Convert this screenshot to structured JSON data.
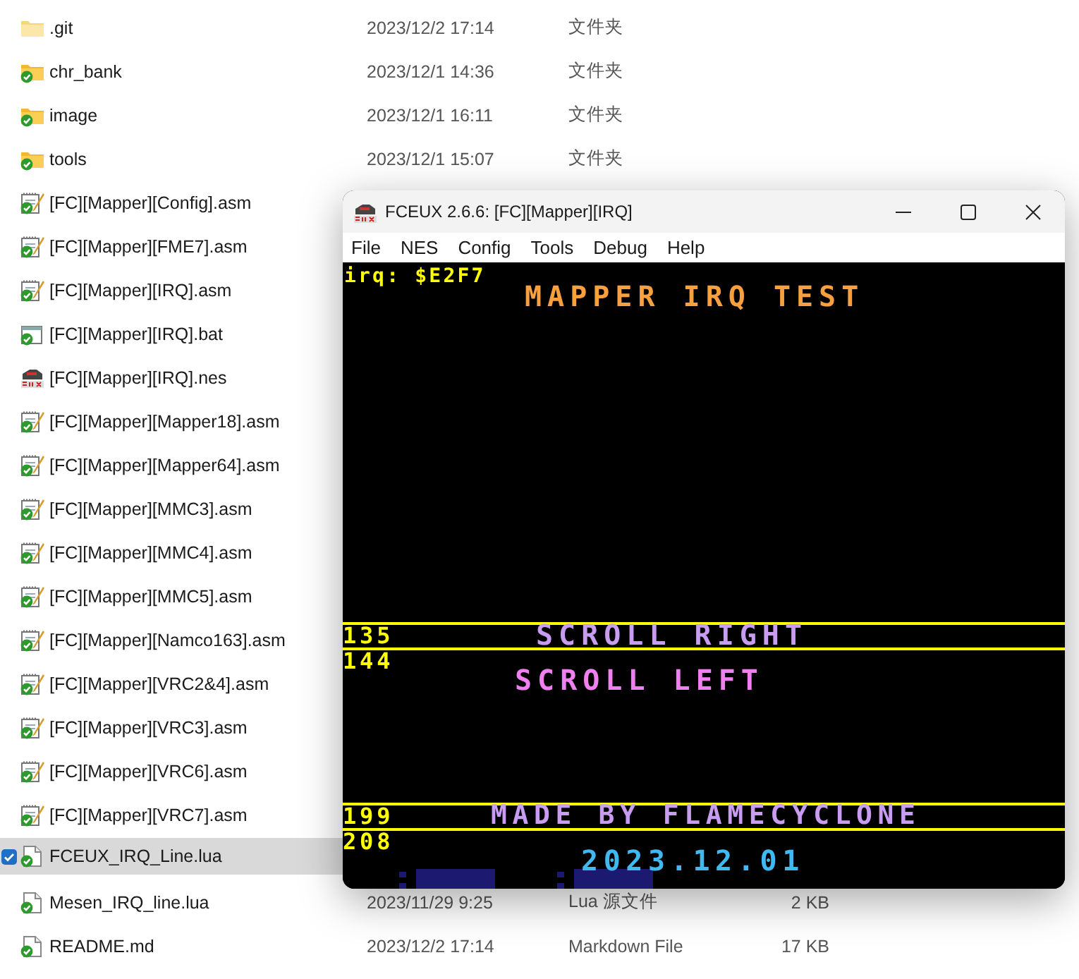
{
  "explorer": {
    "files": [
      {
        "name": ".git",
        "kind": "folder",
        "synced": false,
        "selected": false,
        "modified": "2023/12/2 17:14",
        "type": "文件夹"
      },
      {
        "name": "chr_bank",
        "kind": "folder",
        "synced": true,
        "selected": false,
        "modified": "2023/12/1 14:36",
        "type": "文件夹"
      },
      {
        "name": "image",
        "kind": "folder",
        "synced": true,
        "selected": false,
        "modified": "2023/12/1 16:11",
        "type": "文件夹"
      },
      {
        "name": "tools",
        "kind": "folder",
        "synced": true,
        "selected": false,
        "modified": "2023/12/1 15:07",
        "type": "文件夹"
      },
      {
        "name": "[FC][Mapper][Config].asm",
        "kind": "asm",
        "synced": true,
        "selected": false
      },
      {
        "name": "[FC][Mapper][FME7].asm",
        "kind": "asm",
        "synced": true,
        "selected": false
      },
      {
        "name": "[FC][Mapper][IRQ].asm",
        "kind": "asm",
        "synced": true,
        "selected": false
      },
      {
        "name": "[FC][Mapper][IRQ].bat",
        "kind": "bat",
        "synced": true,
        "selected": false
      },
      {
        "name": "[FC][Mapper][IRQ].nes",
        "kind": "nes",
        "synced": false,
        "selected": false
      },
      {
        "name": "[FC][Mapper][Mapper18].asm",
        "kind": "asm",
        "synced": true,
        "selected": false
      },
      {
        "name": "[FC][Mapper][Mapper64].asm",
        "kind": "asm",
        "synced": true,
        "selected": false
      },
      {
        "name": "[FC][Mapper][MMC3].asm",
        "kind": "asm",
        "synced": true,
        "selected": false
      },
      {
        "name": "[FC][Mapper][MMC4].asm",
        "kind": "asm",
        "synced": true,
        "selected": false
      },
      {
        "name": "[FC][Mapper][MMC5].asm",
        "kind": "asm",
        "synced": true,
        "selected": false
      },
      {
        "name": "[FC][Mapper][Namco163].asm",
        "kind": "asm",
        "synced": true,
        "selected": false
      },
      {
        "name": "[FC][Mapper][VRC2&4].asm",
        "kind": "asm",
        "synced": true,
        "selected": false
      },
      {
        "name": "[FC][Mapper][VRC3].asm",
        "kind": "asm",
        "synced": true,
        "selected": false
      },
      {
        "name": "[FC][Mapper][VRC6].asm",
        "kind": "asm",
        "synced": true,
        "selected": false
      },
      {
        "name": "[FC][Mapper][VRC7].asm",
        "kind": "asm",
        "synced": true,
        "selected": false
      },
      {
        "name": "FCEUX_IRQ_Line.lua",
        "kind": "doc",
        "synced": true,
        "selected": true
      },
      {
        "name": "Mesen_IRQ_line.lua",
        "kind": "doc",
        "synced": true,
        "selected": false,
        "modified": "2023/11/29 9:25",
        "type": "Lua 源文件",
        "size": "2 KB"
      },
      {
        "name": "README.md",
        "kind": "doc",
        "synced": true,
        "selected": false,
        "modified": "2023/12/2 17:14",
        "type": "Markdown File",
        "size": "17 KB"
      }
    ]
  },
  "emulator": {
    "title": "FCEUX 2.6.6: [FC][Mapper][IRQ]",
    "menu": [
      "File",
      "NES",
      "Config",
      "Tools",
      "Debug",
      "Help"
    ],
    "screen": [
      {
        "kind": "counter",
        "text": "irq: $E2F7"
      },
      {
        "kind": "heading",
        "text": "MAPPER IRQ TEST",
        "color": "#f8a040"
      },
      {
        "kind": "line_number",
        "text": "135"
      },
      {
        "kind": "banner",
        "text": "SCROLL RIGHT",
        "color": "#c89cf0"
      },
      {
        "kind": "line_number",
        "text": "144"
      },
      {
        "kind": "banner",
        "text": "SCROLL LEFT",
        "color": "#f080f0"
      },
      {
        "kind": "line_number",
        "text": "199"
      },
      {
        "kind": "banner",
        "text": "MADE BY FLAMECYCLONE",
        "color": "#c89cf0"
      },
      {
        "kind": "line_number",
        "text": "208"
      },
      {
        "kind": "banner",
        "text": "2023.12.01",
        "color": "#40b8f0"
      }
    ]
  }
}
